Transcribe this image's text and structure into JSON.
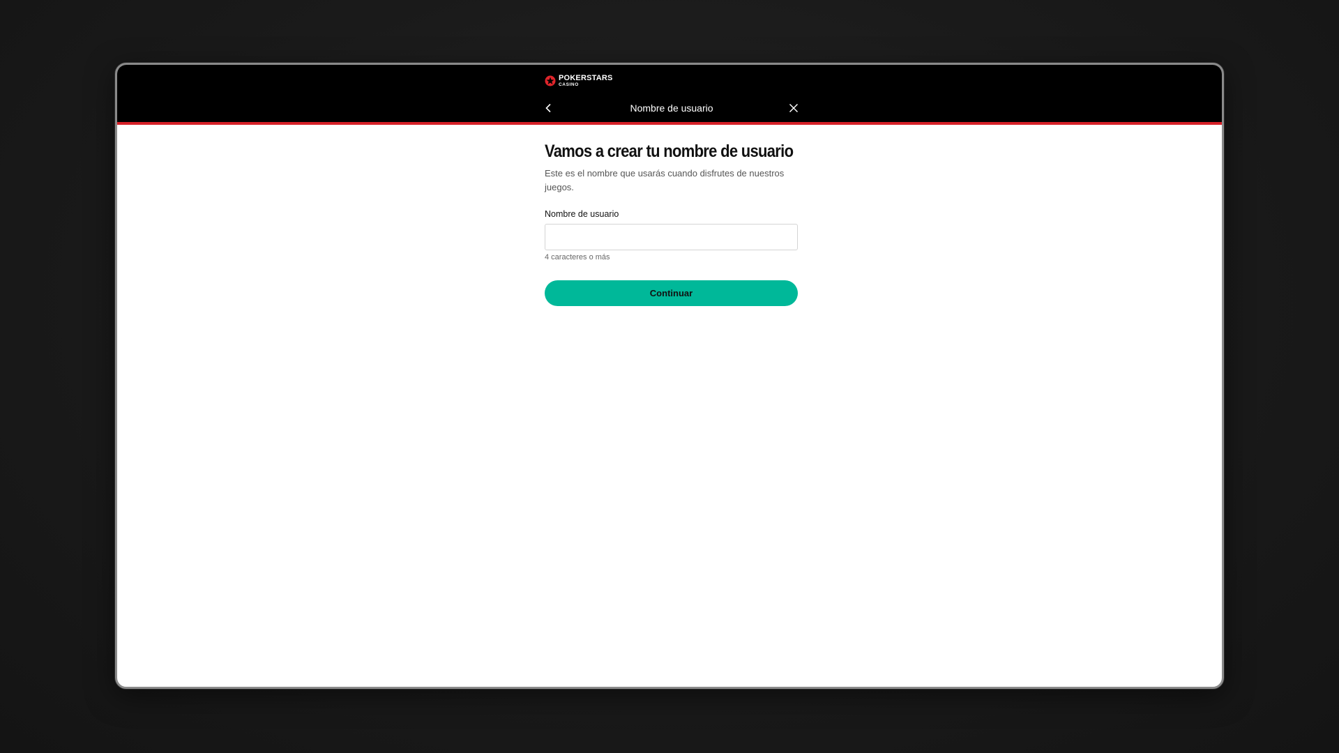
{
  "brand": {
    "name": "POKERSTARS",
    "sub": "CASINO",
    "icon": "star-logo-icon",
    "color": "#e0252b"
  },
  "nav": {
    "title": "Nombre de usuario",
    "back_icon": "chevron-left-icon",
    "close_icon": "close-icon"
  },
  "form": {
    "heading": "Vamos a crear tu nombre de usuario",
    "description": "Este es el nombre que usarás cuando disfrutes de nuestros juegos.",
    "username_label": "Nombre de usuario",
    "username_value": "",
    "username_hint": "4 caracteres o más",
    "continue_label": "Continuar"
  },
  "colors": {
    "accent_bar": "#d62128",
    "button": "#00b899"
  }
}
